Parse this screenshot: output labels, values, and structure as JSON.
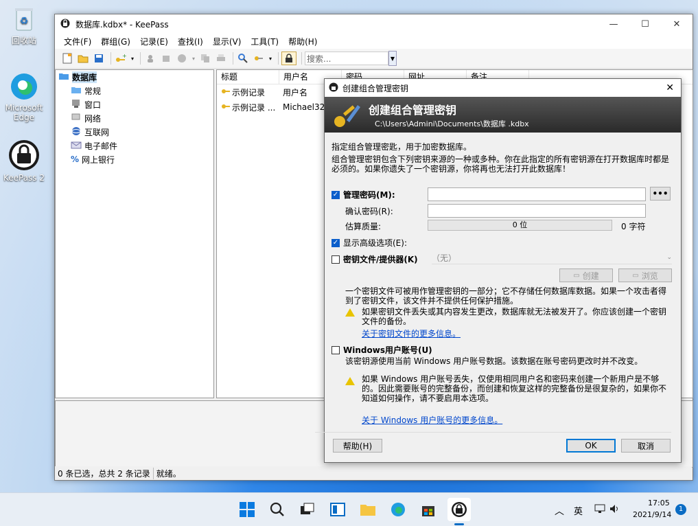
{
  "desktop": {
    "icons": [
      {
        "label": "回收站"
      },
      {
        "label": "Microsoft Edge"
      },
      {
        "label": "KeePass 2"
      }
    ]
  },
  "window": {
    "title": "数据库.kdbx* - KeePass",
    "menu": [
      "文件(F)",
      "群组(G)",
      "记录(E)",
      "查找(I)",
      "显示(V)",
      "工具(T)",
      "帮助(H)"
    ],
    "search_placeholder": "搜索...",
    "tree": [
      {
        "label": "数据库",
        "icon": "folder-open-icon"
      },
      {
        "label": "常规",
        "icon": "folder-icon"
      },
      {
        "label": "窗口",
        "icon": "window-icon"
      },
      {
        "label": "网络",
        "icon": "network-icon"
      },
      {
        "label": "互联网",
        "icon": "globe-icon"
      },
      {
        "label": "电子邮件",
        "icon": "mail-icon"
      },
      {
        "label": "网上银行",
        "icon": "percent-icon"
      }
    ],
    "columns": [
      "标题",
      "用户名",
      "密码",
      "网址",
      "备注"
    ],
    "rows": [
      {
        "title": "示例记录",
        "user": "用户名"
      },
      {
        "title": "示例记录 ...",
        "user": "Michael32"
      }
    ],
    "status": {
      "selected": "0 条已选，总共 2 条记录",
      "state": "就绪。"
    }
  },
  "dialog": {
    "title": "创建组合管理密钥",
    "heading": "创建组合管理密钥",
    "path": "C:\\Users\\Admini\\Documents\\数据库 .kdbx",
    "intro": "指定组合管理密匙，用于加密数据库。",
    "desc": "组合管理密钥包含下列密钥来源的一种或多种。你在此指定的所有密钥源在打开数据库时都是必须的。如果你遗失了一个密钥源，你将再也无法打开此数据库！",
    "master_pw_label": "管理密码(M):",
    "confirm_label": "确认密码(R):",
    "quality_label": "估算质量:",
    "quality_bits": "0 位",
    "quality_chars": "0 字符",
    "show_advanced": "显示高级选项(E):",
    "keyfile_label": "密钥文件/提供器(K)",
    "keyfile_value": "（无）",
    "create_btn": "创建",
    "browse_btn": "浏览",
    "keyfile_desc": "一个密钥文件可被用作管理密钥的一部分；它不存储任何数据库数据。如果一个攻击者得到了密钥文件，该文件并不提供任何保护措施。",
    "keyfile_warn": "如果密钥文件丢失或其内容发生更改，数据库就无法被发开了。你应该创建一个密钥文件的备份。",
    "keyfile_link": "关于密钥文件的更多信息。",
    "win_label": "Windows用户账号(U)",
    "win_desc": "该密钥源使用当前 Windows 用户账号数据。该数据在账号密码更改时并不改变。",
    "win_warn": "如果 Windows 用户账号丢失，仅使用相同用户名和密码来创建一个新用户是不够的。因此需要账号的完整备份，而创建和恢复这样的完整备份是很复杂的，如果你不知道如何操作，请不要启用本选项。",
    "win_link": "关于 Windows 用户账号的更多信息。",
    "help_btn": "帮助(H)",
    "ok_btn": "OK",
    "cancel_btn": "取消",
    "more_btn": "•••"
  },
  "taskbar": {
    "lang": "英",
    "time": "17:05",
    "date": "2021/9/14",
    "badge": "1"
  }
}
